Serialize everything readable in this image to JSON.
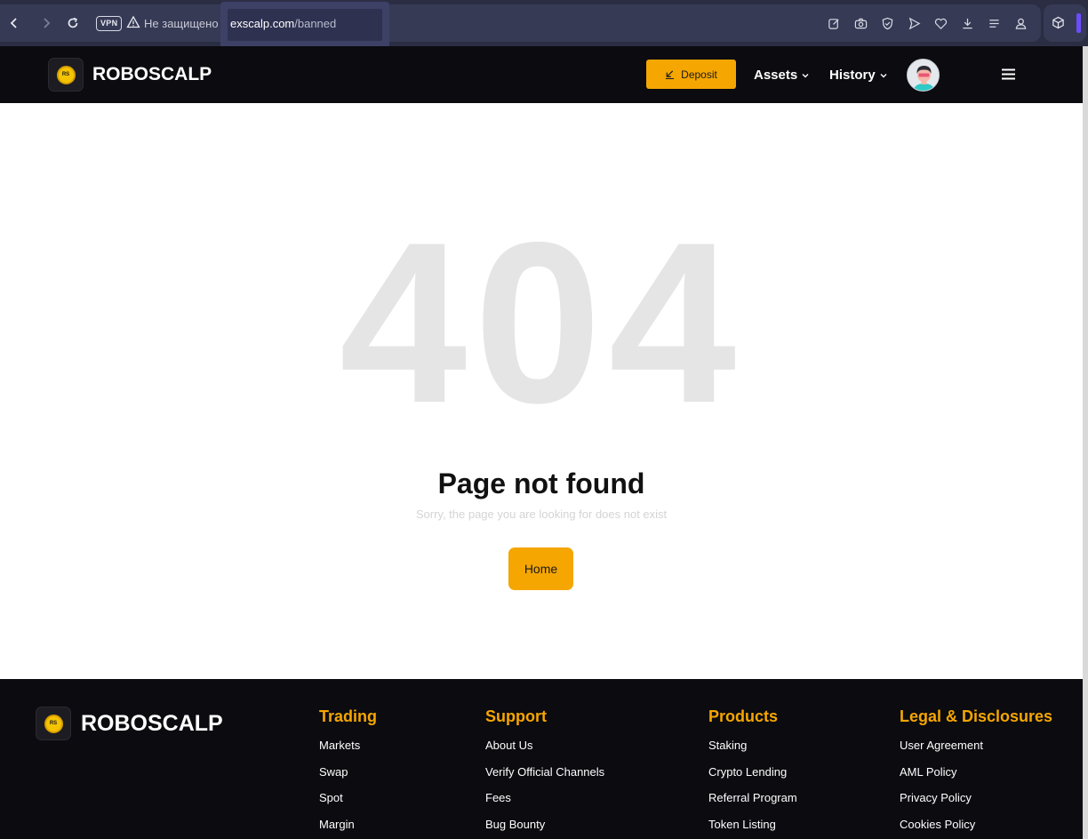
{
  "browser": {
    "vpn_label": "VPN",
    "security_text": "Не защищено",
    "url_host": "exscalp.com",
    "url_path": "/banned"
  },
  "header": {
    "logo_mark": "RS",
    "brand": "ROBOSCALP",
    "deposit_label": "Deposit",
    "nav": [
      {
        "label": "Assets"
      },
      {
        "label": "History"
      }
    ]
  },
  "main": {
    "code": "404",
    "title": "Page not found",
    "subtitle": "Sorry, the page you are looking for does not exist",
    "home_label": "Home"
  },
  "footer": {
    "logo_mark": "RS",
    "brand": "ROBOSCALP",
    "columns": [
      {
        "title": "Trading",
        "links": [
          "Markets",
          "Swap",
          "Spot",
          "Margin"
        ]
      },
      {
        "title": "Support",
        "links": [
          "About Us",
          "Verify Official Channels",
          "Fees",
          "Bug Bounty"
        ]
      },
      {
        "title": "Products",
        "links": [
          "Staking",
          "Crypto Lending",
          "Referral Program",
          "Token Listing"
        ]
      },
      {
        "title": "Legal & Disclosures",
        "links": [
          "User Agreement",
          "AML Policy",
          "Privacy Policy",
          "Cookies Policy"
        ]
      }
    ]
  },
  "colors": {
    "accent": "#f5a600",
    "header_bg": "#0b0b10",
    "muted_404": "#e5e5e5"
  }
}
